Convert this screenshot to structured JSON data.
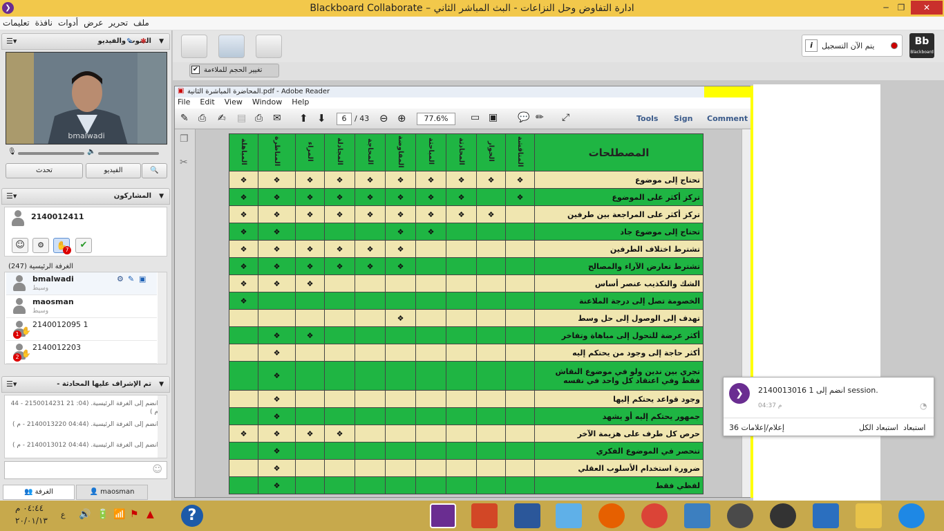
{
  "window": {
    "title": "Blackboard Collaborate – ادارة التفاوض وحل النزاعات - البث المباشر الثاني",
    "min": "─",
    "max": "❐",
    "close": "✕"
  },
  "menu": [
    "ملف",
    "تحرير",
    "عرض",
    "أدوات",
    "نافذة",
    "تعليمات"
  ],
  "av_panel": {
    "title": "الصوت والفيديو",
    "video_name": "bmalwadi",
    "talk": "تحدث",
    "video": "الفيديو"
  },
  "participants": {
    "title": "المشاركون",
    "me": "2140012411",
    "hand_count": "7",
    "room_label": "الغرفة الرئيسية",
    "room_count": "(247)",
    "users": [
      {
        "name": "bmalwadi",
        "role": "وسيط"
      },
      {
        "name": "maosman",
        "role": "وسيط"
      },
      {
        "name": "2140012095 1",
        "badge": "1"
      },
      {
        "name": "2140012203",
        "badge": "2"
      }
    ]
  },
  "chat": {
    "title": "تم الإشراف عليها المحادثة -",
    "messages": [
      "انضم إلى الغرفة الرئيسية. (04: 21 2150014231 - 44 م )",
      "انضم إلى الغرفة الرئيسية. (04:44  2140013220 - م )",
      "انضم إلى الغرفة الرئيسية. (04:44  2140013012 - م )"
    ],
    "tab_room": "الغرفة",
    "tab_user": "maosman"
  },
  "recording": {
    "label": "يتم الآن التسجيل",
    "info": "i",
    "logo": "Bb",
    "logo_sub": "Blackboard"
  },
  "fit": {
    "label": "تغيير الحجم للملاءمة"
  },
  "reader": {
    "title": "المحاضرة المباشرة الثانية.pdf - Adobe Reader",
    "menu": [
      "File",
      "Edit",
      "View",
      "Window",
      "Help"
    ],
    "page": "6",
    "pages": "/ 43",
    "zoom": "77.6%",
    "tools": "Tools",
    "sign": "Sign",
    "comment": "Comment"
  },
  "table": {
    "header": "المصطلحات",
    "cols": [
      "المناقشة",
      "الحوار",
      "المحادثة",
      "المباحثة",
      "المفاوضة",
      "المحاجة",
      "المجادلة",
      "المراء",
      "المناظرة",
      "المباهلة"
    ],
    "rows": [
      {
        "term": "تحتاج إلى موضوع",
        "marks": [
          1,
          1,
          1,
          1,
          1,
          1,
          1,
          1,
          1,
          1
        ],
        "c": "y"
      },
      {
        "term": "تركز أكثر على الموضوع",
        "marks": [
          1,
          0,
          1,
          1,
          1,
          1,
          1,
          1,
          1,
          1
        ],
        "c": "g"
      },
      {
        "term": "تركز أكثر على المراجعة بين طرفين",
        "marks": [
          0,
          1,
          1,
          1,
          1,
          1,
          1,
          1,
          1,
          1
        ],
        "c": "y"
      },
      {
        "term": "تحتاج إلى موضوع جاد",
        "marks": [
          0,
          0,
          0,
          1,
          1,
          0,
          0,
          0,
          1,
          1
        ],
        "c": "g"
      },
      {
        "term": "تشترط اختلاف الطرفين",
        "marks": [
          0,
          0,
          0,
          0,
          1,
          1,
          1,
          1,
          1,
          1
        ],
        "c": "y"
      },
      {
        "term": "تشترط تعارض الآراء والمصالح",
        "marks": [
          0,
          0,
          0,
          0,
          1,
          1,
          1,
          1,
          1,
          1
        ],
        "c": "g"
      },
      {
        "term": "الشك والتكذيب عنصر أساس",
        "marks": [
          0,
          0,
          0,
          0,
          0,
          0,
          0,
          1,
          1,
          1
        ],
        "c": "y"
      },
      {
        "term": "الخصومة تصل إلى درجة الملاعنة",
        "marks": [
          0,
          0,
          0,
          0,
          0,
          0,
          0,
          0,
          0,
          1
        ],
        "c": "g"
      },
      {
        "term": "تهدف إلى الوصول إلى حل وسط",
        "marks": [
          0,
          0,
          0,
          0,
          1,
          0,
          0,
          0,
          0,
          0
        ],
        "c": "y"
      },
      {
        "term": "أكثر عرضة للتحول إلى مباهاة وتفاخر",
        "marks": [
          0,
          0,
          0,
          0,
          0,
          0,
          0,
          1,
          1,
          0
        ],
        "c": "g"
      },
      {
        "term": "أكثر حاجة إلى وجود من يحتكم إليه",
        "marks": [
          0,
          0,
          0,
          0,
          0,
          0,
          0,
          0,
          1,
          0
        ],
        "c": "y"
      },
      {
        "term": "تجري بين ندين ولو في موضوع النقاش فقط وفي اعتقاد كل واحد في نفسه",
        "marks": [
          0,
          0,
          0,
          0,
          0,
          0,
          0,
          0,
          1,
          0
        ],
        "c": "g",
        "tall": true
      },
      {
        "term": "وجود قواعد يحتكم إليها",
        "marks": [
          0,
          0,
          0,
          0,
          0,
          0,
          0,
          0,
          1,
          0
        ],
        "c": "y"
      },
      {
        "term": "جمهور يحتكم إليه أو يشهد",
        "marks": [
          0,
          0,
          0,
          0,
          0,
          0,
          0,
          0,
          1,
          0
        ],
        "c": "g"
      },
      {
        "term": "حرص كل طرف على هزيمة الآخر",
        "marks": [
          0,
          0,
          0,
          0,
          0,
          0,
          1,
          1,
          1,
          1
        ],
        "c": "y"
      },
      {
        "term": "تنحصر في الموضوع الفكري",
        "marks": [
          0,
          0,
          0,
          0,
          0,
          0,
          0,
          0,
          1,
          0
        ],
        "c": "g"
      },
      {
        "term": "ضرورة استخدام الأسلوب العقلي",
        "marks": [
          0,
          0,
          0,
          0,
          0,
          0,
          0,
          0,
          1,
          0
        ],
        "c": "y"
      },
      {
        "term": "لفظي فقط",
        "marks": [
          0,
          0,
          0,
          0,
          0,
          0,
          0,
          0,
          1,
          0
        ],
        "c": "g"
      }
    ],
    "mark": "❖"
  },
  "toast": {
    "msg": "2140013016 انضم إلى 1 session.",
    "time": "04:37 م",
    "count": "36 إعلام/إعلامات",
    "dismiss_all": "استبعاد الكل",
    "dismiss": "استبعاد"
  },
  "tray": {
    "time": "٠٤:٤٤ م",
    "date": "٢٠/٠١/١٣",
    "lang": "ع"
  }
}
